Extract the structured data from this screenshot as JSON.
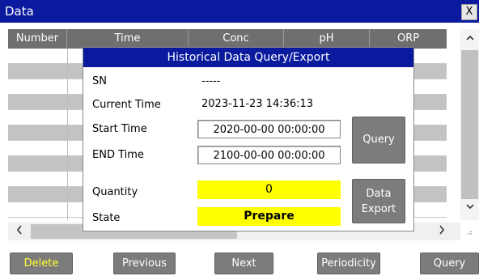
{
  "window": {
    "title": "Data",
    "close_label": "X"
  },
  "table": {
    "columns": [
      "Number",
      "Time",
      "Conc",
      "pH",
      "ORP"
    ]
  },
  "scroll": {
    "up": "^",
    "down": "v",
    "left": "<",
    "right": ">",
    "grip": "::"
  },
  "toolbar": {
    "delete_label": "Delete",
    "previous_label": "Previous",
    "next_label": "Next",
    "periodicity_label": "Periodicity",
    "query_label": "Query"
  },
  "dialog": {
    "title": "Historical Data Query/Export",
    "sn_label": "SN",
    "sn_value": "-----",
    "current_time_label": "Current Time",
    "current_time_value": "2023-11-23 14:36:13",
    "start_time_label": "Start Time",
    "start_time_value": "2020-00-00 00:00:00",
    "end_time_label": "END Time",
    "end_time_value": "2100-00-00 00:00:00",
    "quantity_label": "Quantity",
    "quantity_value": "0",
    "state_label": "State",
    "state_value": "Prepare",
    "query_button": "Query",
    "export_button_line1": "Data",
    "export_button_line2": "Export"
  },
  "colors": {
    "titlebar": "#0a1a9e",
    "highlight": "#ffff00",
    "button": "#7c7c7c"
  }
}
